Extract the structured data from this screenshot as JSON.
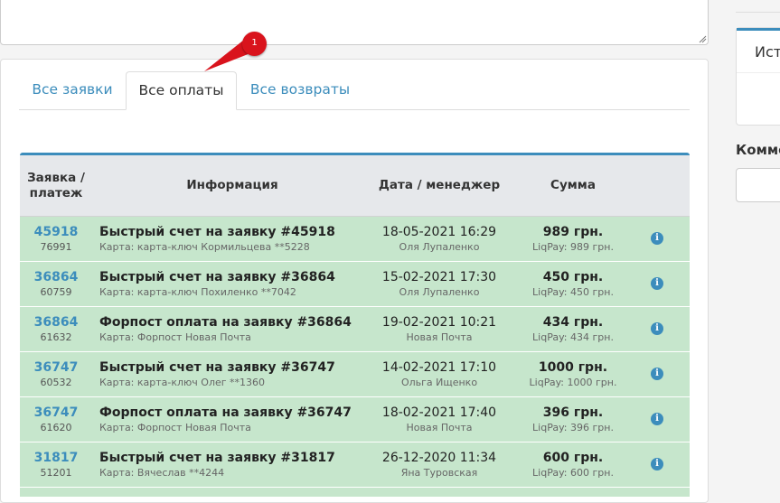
{
  "tabs": [
    {
      "label": "Все заявки",
      "active": false
    },
    {
      "label": "Все оплаты",
      "active": true
    },
    {
      "label": "Все возвраты",
      "active": false
    }
  ],
  "marker": {
    "label": "1",
    "color": "#d9131c"
  },
  "table": {
    "headers": {
      "id": "Заявка / платеж",
      "info": "Информация",
      "date": "Дата / менеджер",
      "sum": "Сумма"
    },
    "rows": [
      {
        "order": "45918",
        "payment": "76991",
        "title": "Быстрый счет на заявку #45918",
        "card": "Карта: карта-ключ Кормильцева **5228",
        "date": "18-05-2021 16:29",
        "manager": "Оля Лупаленко",
        "sum": "989 грн.",
        "method": "LiqPay: 989 грн."
      },
      {
        "order": "36864",
        "payment": "60759",
        "title": "Быстрый счет на заявку #36864",
        "card": "Карта: карта-ключ Похиленко **7042",
        "date": "15-02-2021 17:30",
        "manager": "Оля Лупаленко",
        "sum": "450 грн.",
        "method": "LiqPay: 450 грн."
      },
      {
        "order": "36864",
        "payment": "61632",
        "title": "Форпост оплата на заявку #36864",
        "card": "Карта: Форпост Новая Почта",
        "date": "19-02-2021 10:21",
        "manager": "Новая Почта",
        "sum": "434 грн.",
        "method": "LiqPay: 434 грн."
      },
      {
        "order": "36747",
        "payment": "60532",
        "title": "Быстрый счет на заявку #36747",
        "card": "Карта: карта-ключ Олег **1360",
        "date": "14-02-2021 17:10",
        "manager": "Ольга Ищенко",
        "sum": "1000 грн.",
        "method": "LiqPay: 1000 грн."
      },
      {
        "order": "36747",
        "payment": "61620",
        "title": "Форпост оплата на заявку #36747",
        "card": "Карта: Форпост Новая Почта",
        "date": "18-02-2021 17:40",
        "manager": "Новая Почта",
        "sum": "396 грн.",
        "method": "LiqPay: 396 грн."
      },
      {
        "order": "31817",
        "payment": "51201",
        "title": "Быстрый счет на заявку #31817",
        "card": "Карта: Вячеслав **4244",
        "date": "26-12-2020 11:34",
        "manager": "Яна Туровская",
        "sum": "600 грн.",
        "method": "LiqPay: 600 грн."
      }
    ],
    "row_icon": "info-icon"
  },
  "sidebar": {
    "box_title": "Ист",
    "label": "Комме"
  },
  "colors": {
    "accent": "#3c8dbc",
    "row_green": "#c6e6cc",
    "header_bg": "#e6e8eb"
  }
}
